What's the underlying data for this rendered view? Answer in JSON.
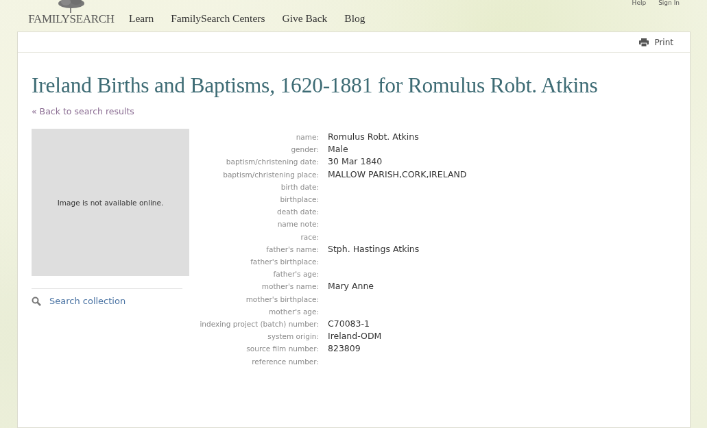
{
  "utility_links": [
    "Help",
    "Sign In"
  ],
  "logo": {
    "text": "FAMILYSEARCH"
  },
  "nav": [
    "Learn",
    "FamilySearch Centers",
    "Give Back",
    "Blog"
  ],
  "toolbar": {
    "print": "Print"
  },
  "title": "Ireland Births and Baptisms, 1620-1881 for Romulus Robt. Atkins",
  "back_link": "« Back to search results",
  "image_placeholder": "Image is not available online.",
  "search_collection": "Search collection",
  "fields": [
    {
      "label": "name:",
      "value": "Romulus Robt. Atkins"
    },
    {
      "label": "gender:",
      "value": "Male"
    },
    {
      "label": "baptism/christening date:",
      "value": "30 Mar 1840"
    },
    {
      "label": "baptism/christening place:",
      "value": "MALLOW PARISH,CORK,IRELAND"
    },
    {
      "label": "birth date:"
    },
    {
      "label": "birthplace:"
    },
    {
      "label": "death date:"
    },
    {
      "label": "name note:"
    },
    {
      "label": "race:"
    },
    {
      "label": "father's name:",
      "value": "Stph. Hastings Atkins"
    },
    {
      "label": "father's birthplace:"
    },
    {
      "label": "father's age:"
    },
    {
      "label": "mother's name:",
      "value": "Mary Anne"
    },
    {
      "label": "mother's birthplace:"
    },
    {
      "label": "mother's age:"
    },
    {
      "label": "indexing project (batch) number:",
      "value": "C70083-1"
    },
    {
      "label": "system origin:",
      "value": "Ireland-ODM"
    },
    {
      "label": "source film number:",
      "value": "823809"
    },
    {
      "label": "reference number:"
    }
  ]
}
